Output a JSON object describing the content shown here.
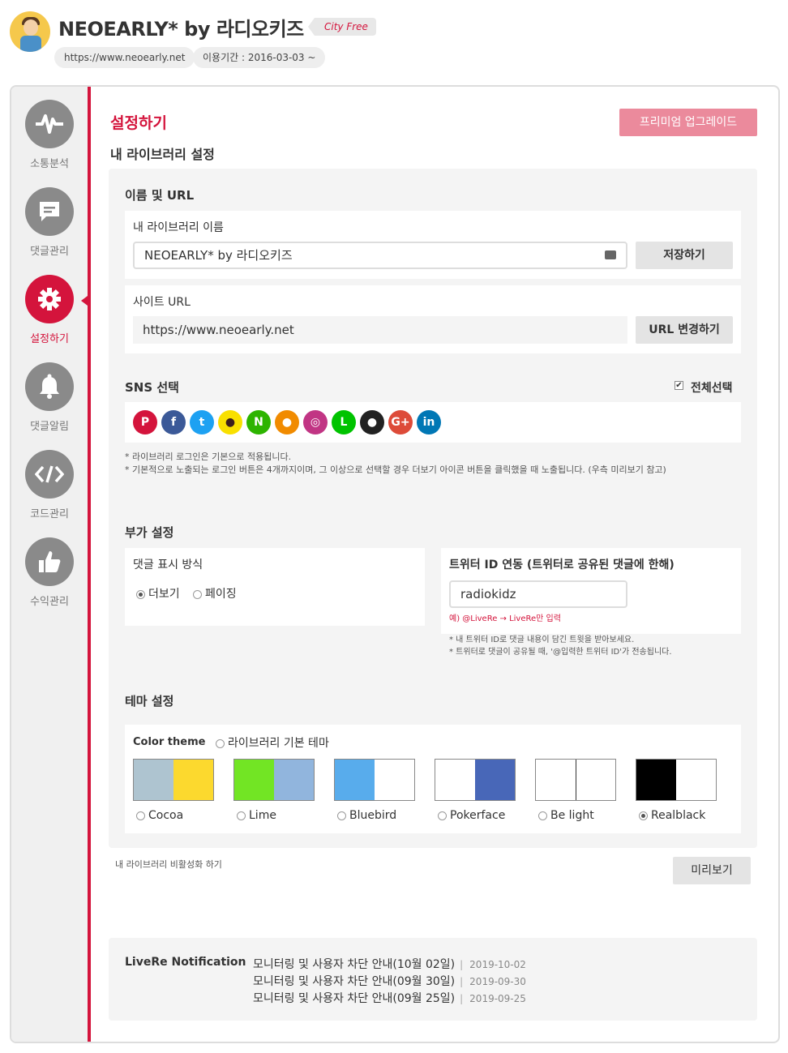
{
  "header": {
    "title": "NEOEARLY* by 라디오키즈",
    "plan": "City Free",
    "site_url": "https://www.neoearly.net",
    "period": "이용기간 : 2016-03-03 ~"
  },
  "sidebar": {
    "items": [
      {
        "label": "소통분석",
        "icon": "pulse-icon"
      },
      {
        "label": "댓글관리",
        "icon": "comment-icon"
      },
      {
        "label": "설정하기",
        "icon": "gear-icon"
      },
      {
        "label": "댓글알림",
        "icon": "bell-icon"
      },
      {
        "label": "코드관리",
        "icon": "code-icon"
      },
      {
        "label": "수익관리",
        "icon": "thumbs-up-icon"
      }
    ],
    "active_index": 2
  },
  "main": {
    "title": "설정하기",
    "subtitle": "내 라이브러리 설정",
    "premium_button": "프리미엄 업그레이드",
    "name_url": {
      "section_title": "이름 및 URL",
      "library_name_label": "내 라이브러리 이름",
      "library_name_value": "NEOEARLY* by 라디오키즈",
      "save_button": "저장하기",
      "site_url_label": "사이트 URL",
      "site_url_value": "https://www.neoearly.net",
      "url_change_button": "URL 변경하기"
    },
    "sns": {
      "section_title": "SNS 선택",
      "select_all": "전체선택",
      "select_all_checked": true,
      "icons": [
        {
          "name": "pinterest",
          "color": "#d4143c",
          "glyph": "P"
        },
        {
          "name": "facebook",
          "color": "#3b5998",
          "glyph": "f"
        },
        {
          "name": "twitter",
          "color": "#1da1f2",
          "glyph": "t"
        },
        {
          "name": "kakaotalk",
          "color": "#f9e000",
          "glyph": "●"
        },
        {
          "name": "naver",
          "color": "#2db400",
          "glyph": "N"
        },
        {
          "name": "kakaostory",
          "color": "#f18b00",
          "glyph": "●"
        },
        {
          "name": "instagram",
          "color": "#c13584",
          "glyph": "◎"
        },
        {
          "name": "line",
          "color": "#00c300",
          "glyph": "L"
        },
        {
          "name": "github",
          "color": "#222222",
          "glyph": "●"
        },
        {
          "name": "google-plus",
          "color": "#dd4b39",
          "glyph": "G+"
        },
        {
          "name": "linkedin",
          "color": "#0077b5",
          "glyph": "in"
        }
      ],
      "note1": "* 라이브러리 로그인은 기본으로 적용됩니다.",
      "note2": "* 기본적으로 노출되는 로그인 버튼은 4개까지이며, 그 이상으로 선택할 경우 더보기 아이콘 버튼을 클릭했을 때 노출됩니다. (우측 미리보기 참고)"
    },
    "extra": {
      "section_title": "부가 설정",
      "comment_display_label": "댓글 표시 방식",
      "options": [
        "더보기",
        "페이징"
      ],
      "selected_option": 0,
      "twitter_label": "트위터 ID 연동 (트위터로 공유된 댓글에 한해)",
      "twitter_value": "radiokidz",
      "twitter_example": "예) @LiveRe → LiveRe만 입력",
      "twitter_note1": "* 내 트위터 ID로 댓글 내용이 담긴 트윗을 받아보세요.",
      "twitter_note2": "* 트위터로 댓글이 공유될 때, '@입력한 트위터 ID'가 전송됩니다."
    },
    "theme": {
      "section_title": "테마 설정",
      "color_theme_label": "Color theme",
      "default_theme_label": "라이브러리 기본 테마",
      "themes": [
        {
          "name": "Cocoa",
          "colors": [
            "#aec4d0",
            "#fcd92e"
          ]
        },
        {
          "name": "Lime",
          "colors": [
            "#72e524",
            "#91b5dd"
          ]
        },
        {
          "name": "Bluebird",
          "colors": [
            "#58acec",
            "#ffffff"
          ]
        },
        {
          "name": "Pokerface",
          "colors": [
            "#ffffff",
            "#4867b8"
          ]
        },
        {
          "name": "Be light",
          "colors": [
            "#ffffff",
            "#ffffff"
          ]
        },
        {
          "name": "Realblack",
          "colors": [
            "#000000",
            "#ffffff"
          ]
        }
      ],
      "selected_theme": 5
    },
    "deactivate_link": "내 라이브러리 비활성화 하기",
    "preview_button": "미리보기"
  },
  "notification": {
    "title": "LiveRe Notification",
    "items": [
      {
        "text": "모니터링 및 사용자 차단 안내(10월 02일)",
        "date": "2019-10-02"
      },
      {
        "text": "모니터링 및 사용자 차단 안내(09월 30일)",
        "date": "2019-09-30"
      },
      {
        "text": "모니터링 및 사용자 차단 안내(09월 25일)",
        "date": "2019-09-25"
      }
    ]
  },
  "colors": {
    "accent": "#d4143c",
    "premium": "#eb8a9c",
    "sidebar_icon": "#8a8a8a"
  }
}
